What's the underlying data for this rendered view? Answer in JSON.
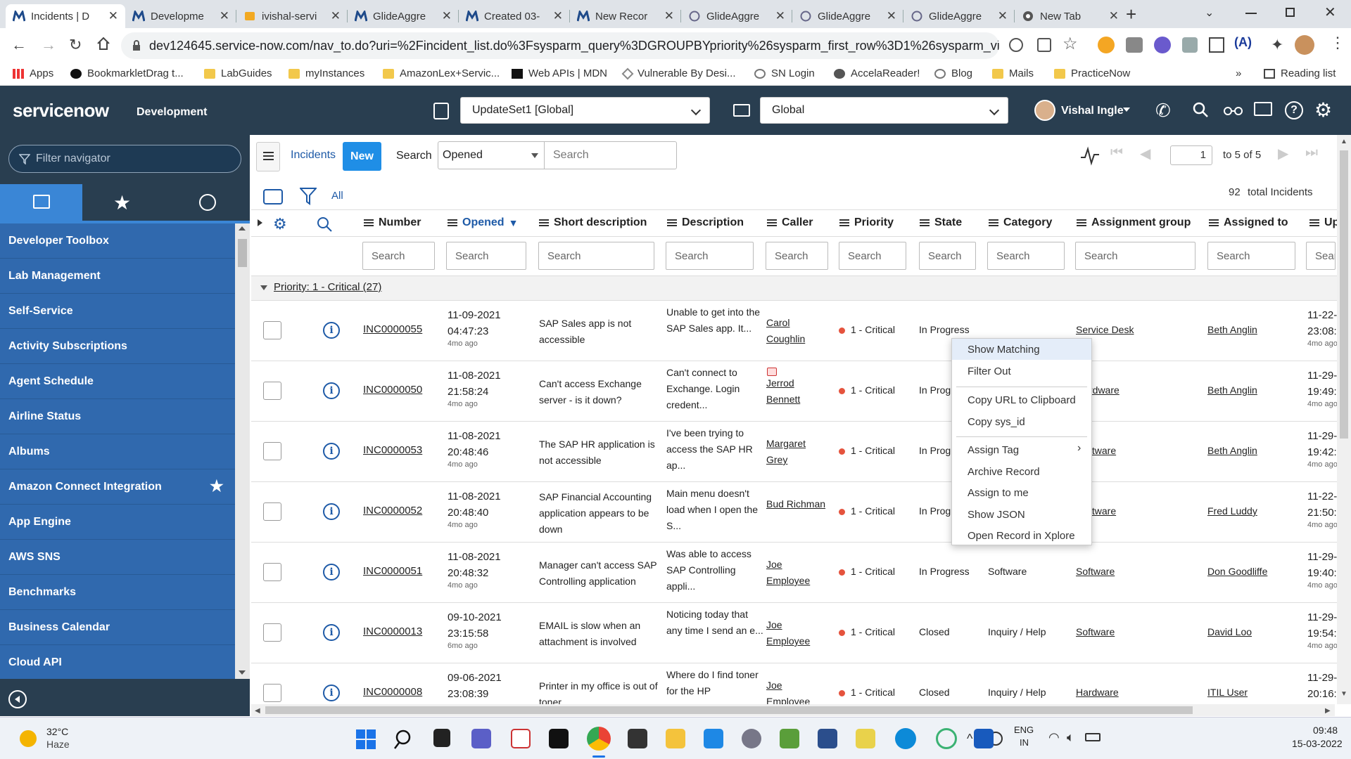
{
  "browser": {
    "tabs": [
      {
        "title": "Incidents | D",
        "active": true
      },
      {
        "title": "Developme",
        "active": false
      },
      {
        "title": "ivishal-servi",
        "active": false
      },
      {
        "title": "GlideAggre",
        "active": false
      },
      {
        "title": "Created 03-",
        "active": false
      },
      {
        "title": "New Recor",
        "active": false
      },
      {
        "title": "GlideAggre",
        "active": false
      },
      {
        "title": "GlideAggre",
        "active": false
      },
      {
        "title": "GlideAggre",
        "active": false
      },
      {
        "title": "New Tab",
        "active": false
      }
    ],
    "url": "dev124645.service-now.com/nav_to.do?uri=%2Fincident_list.do%3Fsysparm_query%3DGROUPBYpriority%26sysparm_first_row%3D1%26sysparm_view%3D",
    "bookmarks": [
      "Apps",
      "BookmarkletDrag t...",
      "LabGuides",
      "myInstances",
      "AmazonLex+Servic...",
      "Web APIs | MDN",
      "Vulnerable By Desi...",
      "SN Login",
      "AccelaReader!",
      "Blog",
      "Mails",
      "PracticeNow"
    ],
    "bookmarks_overflow": "»",
    "reading_list": "Reading list"
  },
  "sn_header": {
    "logo": "servicenow",
    "instance": "Development",
    "update_set": "UpdateSet1 [Global]",
    "scope": "Global",
    "user": "Vishal Ingle"
  },
  "navigator": {
    "filter_placeholder": "Filter navigator",
    "items": [
      "Developer Toolbox",
      "Lab Management",
      "Self-Service",
      "Activity Subscriptions",
      "Agent Schedule",
      "Airline Status",
      "Albums",
      "Amazon Connect Integration",
      "App Engine",
      "AWS SNS",
      "Benchmarks",
      "Business Calendar",
      "Cloud API"
    ]
  },
  "list": {
    "title": "Incidents",
    "new_label": "New",
    "search_label": "Search",
    "search_field": "Opened",
    "search_placeholder": "Search",
    "page": "1",
    "page_range": "to 5 of 5",
    "filter_all": "All",
    "total": "92",
    "total_label": "total Incidents",
    "columns": [
      "Number",
      "Opened",
      "Short description",
      "Description",
      "Caller",
      "Priority",
      "State",
      "Category",
      "Assignment group",
      "Assigned to",
      "Up"
    ],
    "column_search": "Search",
    "group_label": "Priority: 1 - Critical (27)",
    "rows": [
      {
        "number": "INC0000055",
        "opened_date": "11-09-2021",
        "opened_time": "04:47:23",
        "ago": "4mo ago",
        "short": "SAP Sales app is not accessible",
        "desc": "Unable to get into the SAP Sales app. It...",
        "caller": "Carol Coughlin",
        "priority": "1 - Critical",
        "state": "In Progress",
        "category": "",
        "group": "Service Desk",
        "assigned": "Beth Anglin",
        "upd_date": "11-22-",
        "upd_time": "23:08:",
        "upd_ago": "4mo ago"
      },
      {
        "number": "INC0000050",
        "opened_date": "11-08-2021",
        "opened_time": "21:58:24",
        "ago": "4mo ago",
        "short": "Can't access Exchange server - is it down?",
        "desc": "Can't connect to Exchange. Login credent...",
        "caller": "Jerrod Bennett",
        "priority": "1 - Critical",
        "state": "In Prog",
        "category": "",
        "group": "rdware",
        "assigned": "Beth Anglin",
        "upd_date": "11-29-",
        "upd_time": "19:49:",
        "upd_ago": "4mo ago"
      },
      {
        "number": "INC0000053",
        "opened_date": "11-08-2021",
        "opened_time": "20:48:46",
        "ago": "4mo ago",
        "short": "The SAP HR application is not accessible",
        "desc": "I've been trying to access the SAP HR ap...",
        "caller": "Margaret Grey",
        "priority": "1 - Critical",
        "state": "In Prog",
        "category": "",
        "group": "ftware",
        "assigned": "Beth Anglin",
        "upd_date": "11-29-",
        "upd_time": "19:42:",
        "upd_ago": "4mo ago"
      },
      {
        "number": "INC0000052",
        "opened_date": "11-08-2021",
        "opened_time": "20:48:40",
        "ago": "4mo ago",
        "short": "SAP Financial Accounting application appears to be down",
        "desc": "Main menu doesn't load when I open the S...",
        "caller": "Bud Richman",
        "priority": "1 - Critical",
        "state": "In Prog",
        "category": "",
        "group": "ftware",
        "assigned": "Fred Luddy",
        "upd_date": "11-22-",
        "upd_time": "21:50:",
        "upd_ago": "4mo ago"
      },
      {
        "number": "INC0000051",
        "opened_date": "11-08-2021",
        "opened_time": "20:48:32",
        "ago": "4mo ago",
        "short": "Manager can't access SAP Controlling application",
        "desc": "Was able to access SAP Controlling appli...",
        "caller": "Joe Employee",
        "priority": "1 - Critical",
        "state": "In Progress",
        "category": "Software",
        "group": "Software",
        "assigned": "Don Goodliffe",
        "upd_date": "11-29-",
        "upd_time": "19:40:",
        "upd_ago": "4mo ago"
      },
      {
        "number": "INC0000013",
        "opened_date": "09-10-2021",
        "opened_time": "23:15:58",
        "ago": "6mo ago",
        "short": "EMAIL is slow when an attachment is involved",
        "desc": "Noticing today that any time I send an e...",
        "caller": "Joe Employee",
        "priority": "1 - Critical",
        "state": "Closed",
        "category": "Inquiry / Help",
        "group": "Software",
        "assigned": "David Loo",
        "upd_date": "11-29-",
        "upd_time": "19:54:",
        "upd_ago": "4mo ago"
      },
      {
        "number": "INC0000008",
        "opened_date": "09-06-2021",
        "opened_time": "23:08:39",
        "ago": "",
        "short": "Printer in my office is out of toner",
        "desc": "Where do I find toner for the HP",
        "caller": "Joe Employee",
        "priority": "1 - Critical",
        "state": "Closed",
        "category": "Inquiry / Help",
        "group": "Hardware",
        "assigned": "ITIL User",
        "upd_date": "11-29-",
        "upd_time": "20:16:",
        "upd_ago": ""
      }
    ]
  },
  "context_menu": [
    "Show Matching",
    "Filter Out",
    "Copy URL to Clipboard",
    "Copy sys_id",
    "Assign Tag",
    "Archive Record",
    "Assign to me",
    "Show JSON",
    "Open Record in Xplore"
  ],
  "taskbar": {
    "temp": "32°C",
    "weather": "Haze",
    "lang1": "ENG",
    "lang2": "IN",
    "time": "09:48",
    "date": "15-03-2022"
  },
  "colors": {
    "sn_header": "#293e50",
    "nav_item": "#3069ae",
    "new_button": "#1f8ee6",
    "priority_dot": "#e5533d",
    "link": "#1e5aa7"
  }
}
